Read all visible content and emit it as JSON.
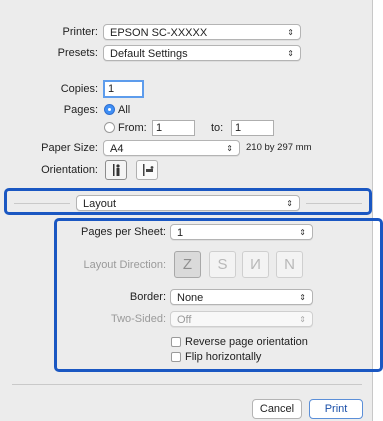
{
  "printer": {
    "label": "Printer:",
    "value": "EPSON SC-XXXXX"
  },
  "presets": {
    "label": "Presets:",
    "value": "Default Settings"
  },
  "copies": {
    "label": "Copies:",
    "value": "1"
  },
  "pages": {
    "label": "Pages:",
    "all_label": "All",
    "from_label": "From:",
    "from_value": "1",
    "to_label": "to:",
    "to_value": "1"
  },
  "paper_size": {
    "label": "Paper Size:",
    "value": "A4",
    "dimensions": "210 by 297 mm"
  },
  "orientation": {
    "label": "Orientation:"
  },
  "section_menu": {
    "value": "Layout"
  },
  "layout": {
    "pages_per_sheet": {
      "label": "Pages per Sheet:",
      "value": "1"
    },
    "layout_direction": {
      "label": "Layout Direction:",
      "options": [
        "Z",
        "S",
        "И",
        "N"
      ]
    },
    "border": {
      "label": "Border:",
      "value": "None"
    },
    "two_sided": {
      "label": "Two-Sided:",
      "value": "Off"
    },
    "reverse_label": "Reverse page orientation",
    "flip_label": "Flip horizontally"
  },
  "buttons": {
    "cancel": "Cancel",
    "print": "Print"
  },
  "colors": {
    "highlight": "#1a57c2",
    "radio_selected": "#3f8ff5",
    "dialog_bg": "#ececec"
  },
  "popup_arrow": "⇕"
}
